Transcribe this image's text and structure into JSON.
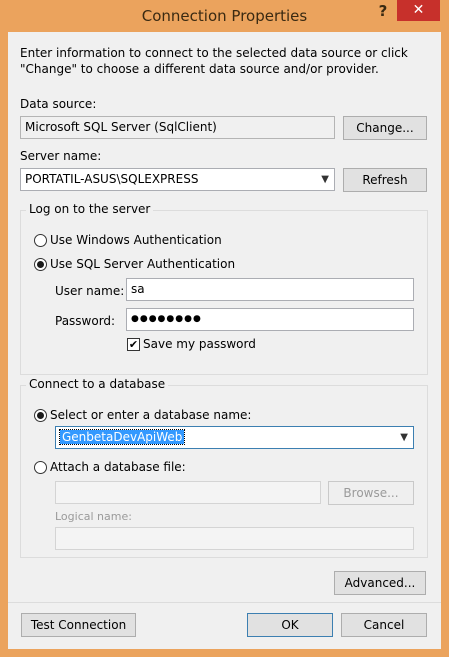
{
  "window": {
    "title": "Connection Properties",
    "help_glyph": "?",
    "close_glyph": "✕"
  },
  "intro_text": "Enter information to connect to the selected data source or click \"Change\" to choose a different data source and/or provider.",
  "data_source": {
    "label": "Data source:",
    "value": "Microsoft SQL Server (SqlClient)",
    "change_button": "Change..."
  },
  "server": {
    "label": "Server name:",
    "value": "PORTATIL-ASUS\\SQLEXPRESS",
    "refresh_button": "Refresh"
  },
  "logon": {
    "group_label": "Log on to the server",
    "windows_auth": "Use Windows Authentication",
    "sql_auth": "Use SQL Server Authentication",
    "username_label": "User name:",
    "username_value": "sa",
    "password_label": "Password:",
    "password_value": "●●●●●●●●",
    "save_password": "Save my password"
  },
  "database": {
    "group_label": "Connect to a database",
    "select_option": "Select or enter a database name:",
    "db_name": "GenbetaDevApiWeb",
    "attach_option": "Attach a database file:",
    "browse_button": "Browse...",
    "logical_name_label": "Logical name:"
  },
  "advanced_button": "Advanced...",
  "footer": {
    "test_button": "Test Connection",
    "ok_button": "OK",
    "cancel_button": "Cancel"
  },
  "colors": {
    "frame": "#eba35d",
    "close": "#c7302b",
    "selection": "#3399ff"
  }
}
